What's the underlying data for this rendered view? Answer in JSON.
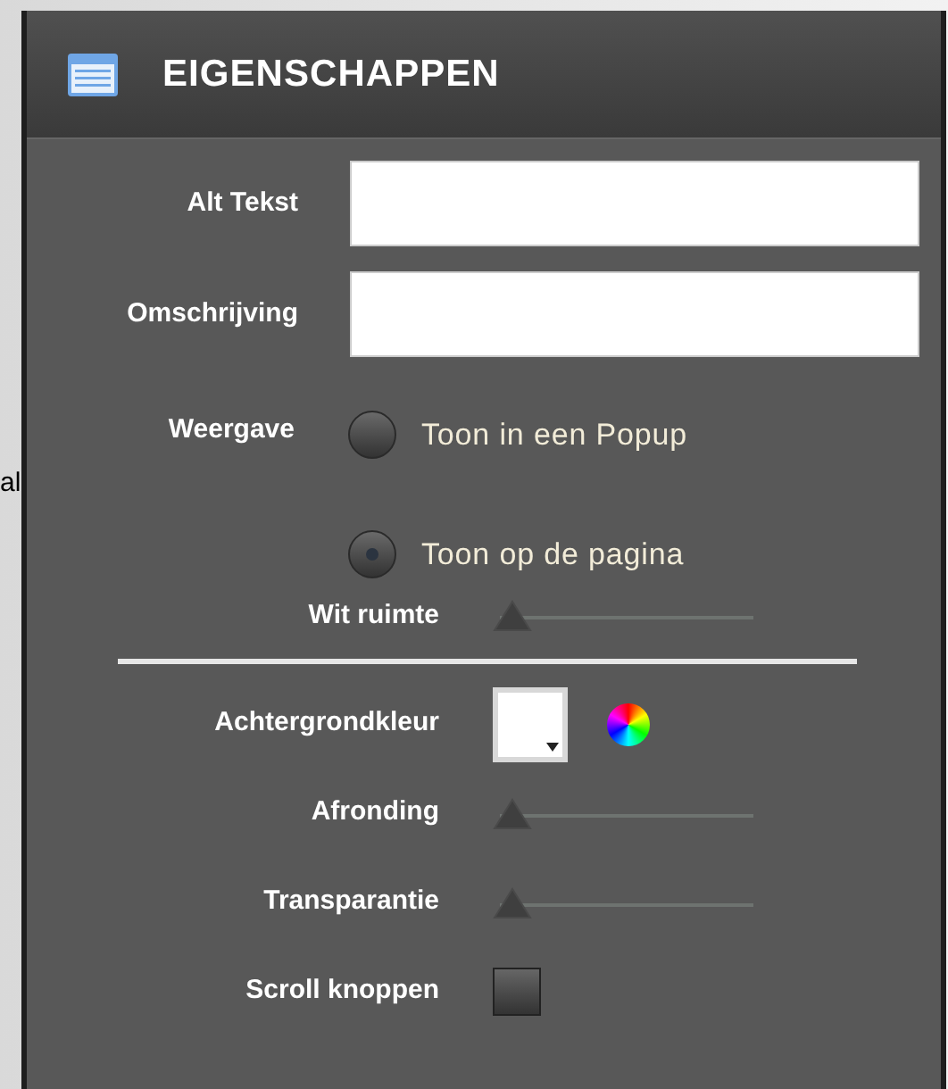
{
  "background_text": "al",
  "panel": {
    "title": "EIGENSCHAPPEN"
  },
  "fields": [
    {
      "label": "Alt Tekst"
    },
    {
      "label": "Omschrijving"
    }
  ],
  "display": {
    "label": "Weergave",
    "options": [
      {
        "label": "Toon in een Popup",
        "selected": false
      },
      {
        "label": "Toon op de pagina",
        "selected": true
      }
    ]
  },
  "whitespace": {
    "label": "Wit ruimte",
    "level": 0
  },
  "properties": [
    {
      "kind": "color",
      "label": "Achtergrondkleur",
      "color": "#ffffff"
    },
    {
      "kind": "slider",
      "label": "Afronding",
      "level": 0
    },
    {
      "kind": "slider",
      "label": "Transparantie",
      "level": 0
    },
    {
      "kind": "checkbox",
      "label": "Scroll knoppen",
      "checked": false
    }
  ]
}
